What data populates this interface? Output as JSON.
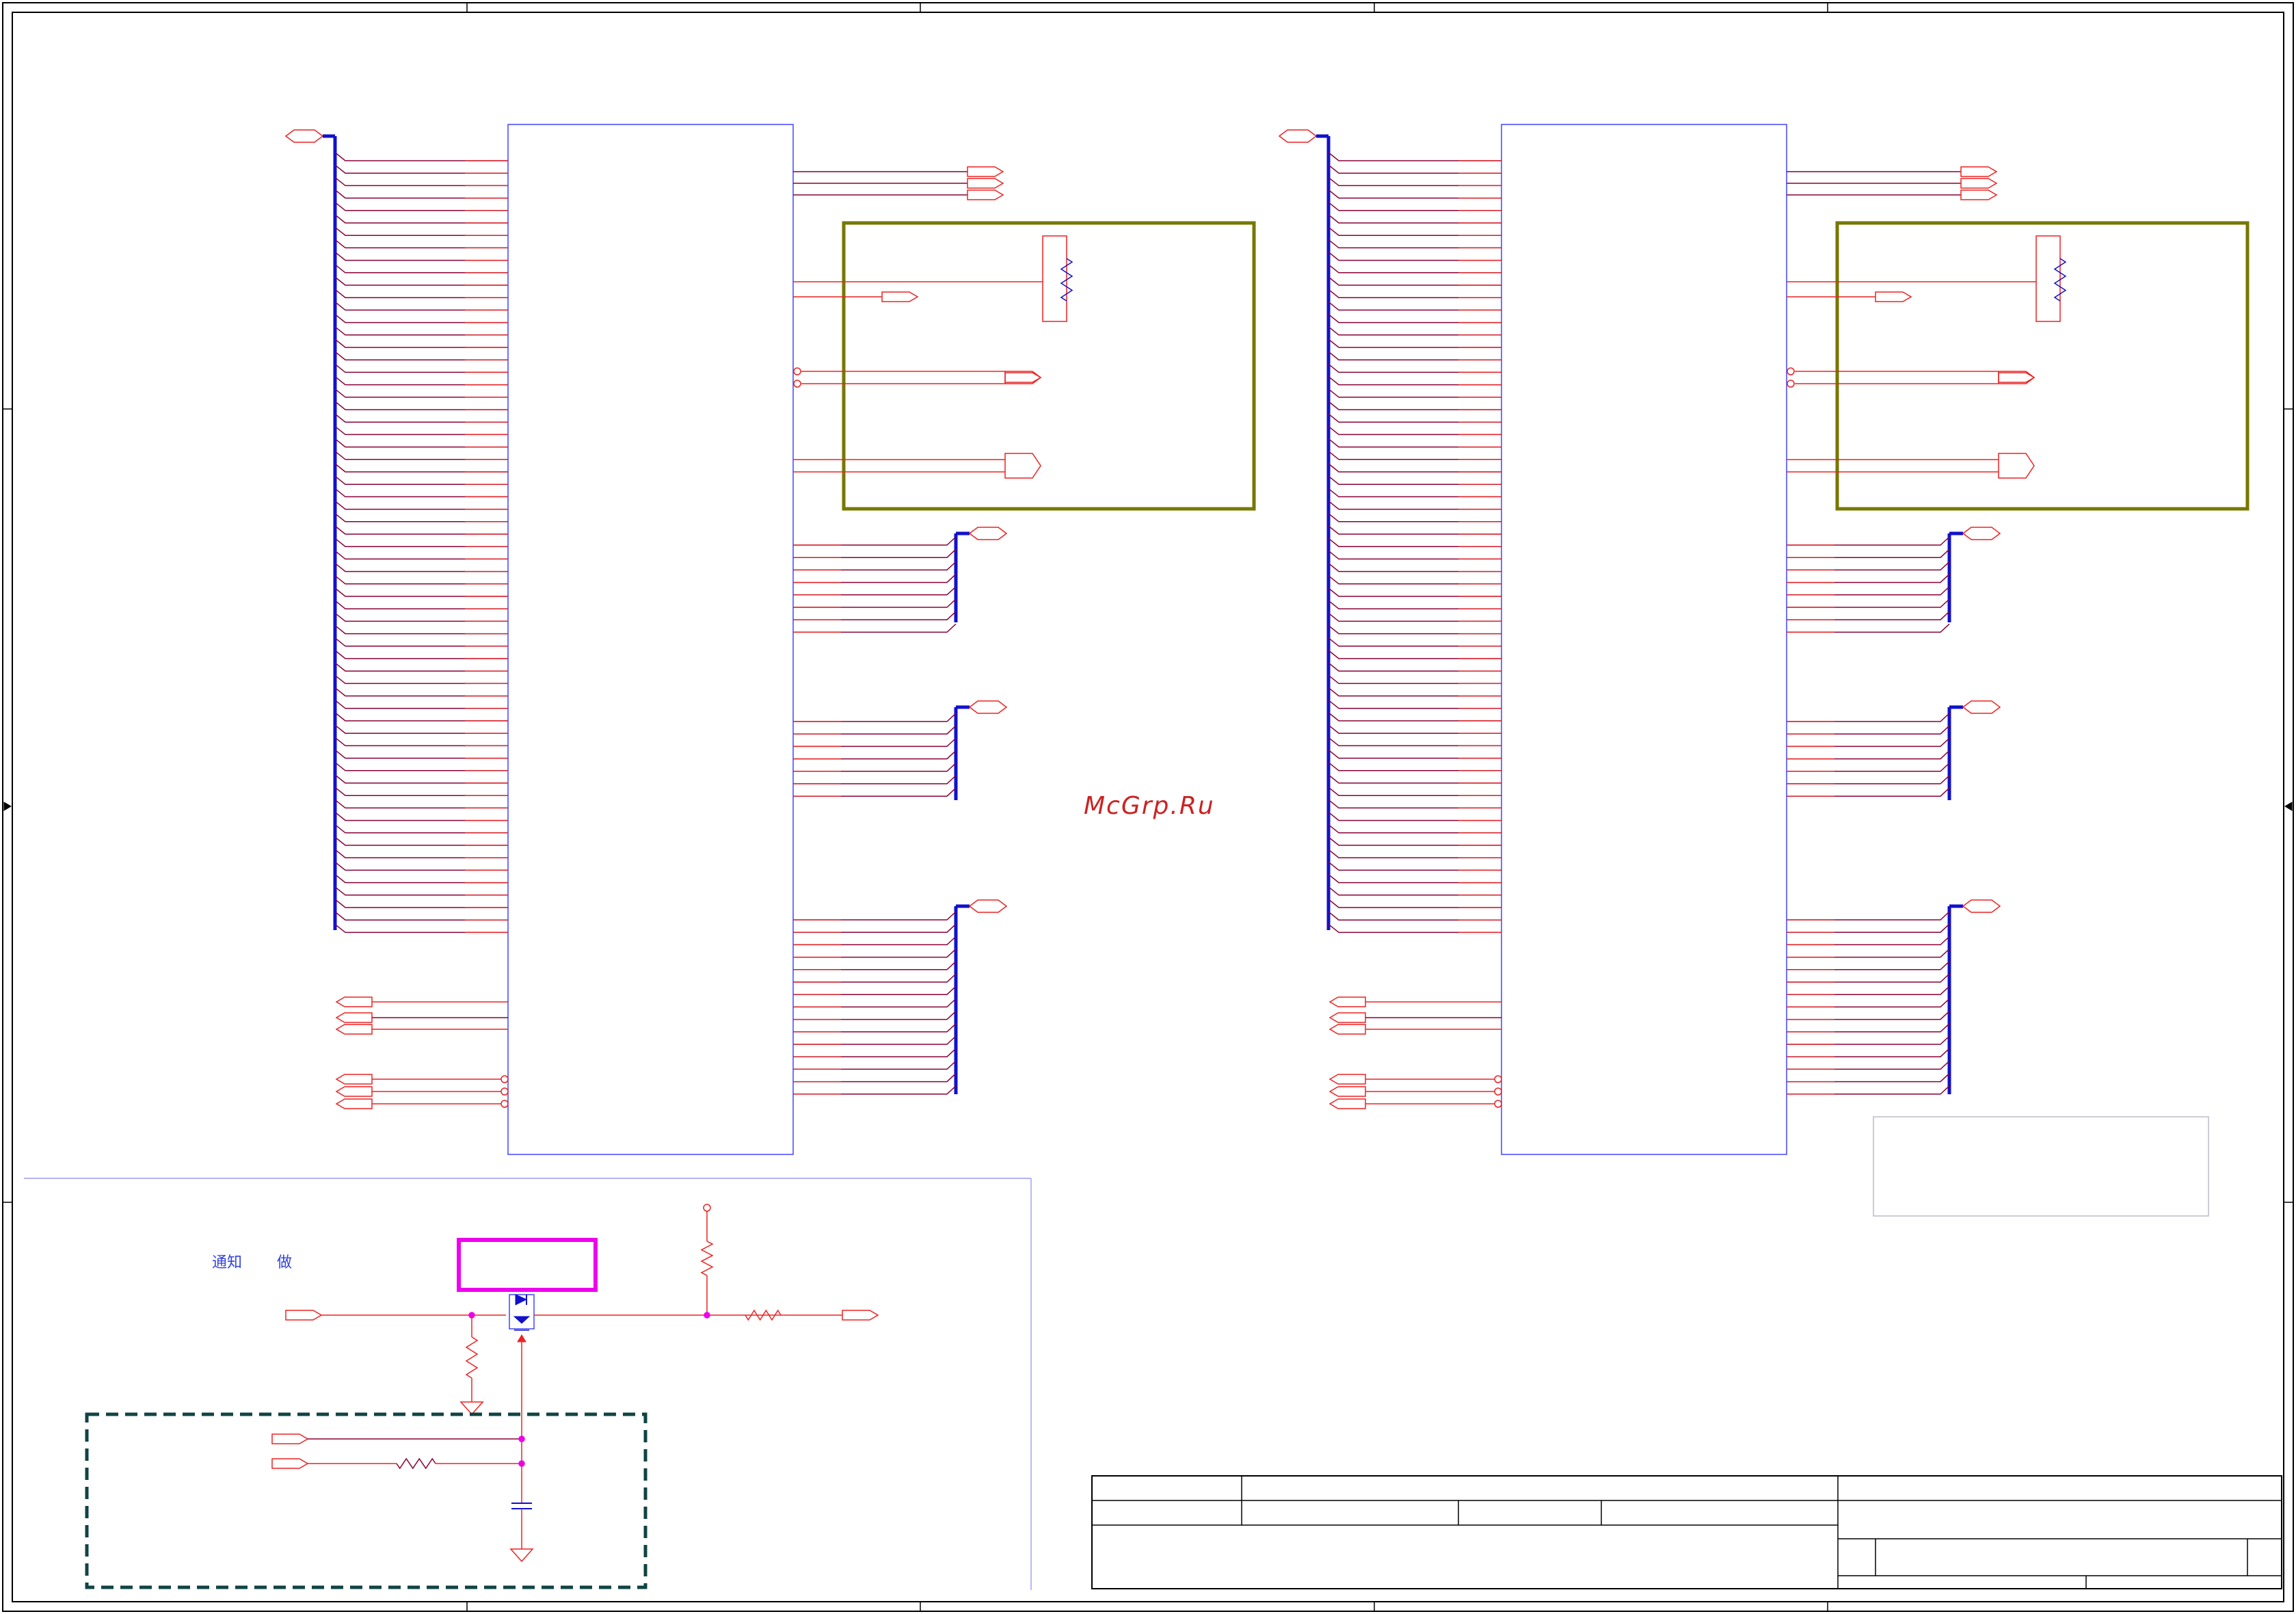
{
  "watermark": "McGrp.Ru",
  "notes": {
    "left": "通知",
    "right": "做"
  },
  "colors": {
    "net": "#ee2222",
    "bus_entry": "#880033",
    "bus": "#1111cc",
    "component_outline": "#4444ff",
    "highlight_box": "#777700",
    "junction": "#ee00ee",
    "dashed_box": "#114444",
    "magenta_box": "#ee00ee",
    "frame": "#000000"
  },
  "icons": [
    "port-arrow-icon",
    "resistor-icon",
    "capacitor-icon",
    "ground-icon",
    "mosfet-icon",
    "power-pin-icon"
  ]
}
